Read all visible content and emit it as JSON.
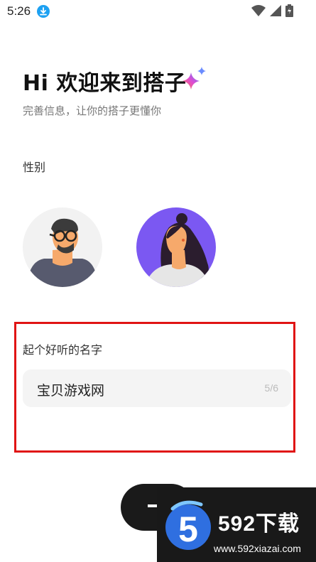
{
  "status_bar": {
    "time": "5:26",
    "icons": [
      "download-icon",
      "wifi-icon",
      "signal-icon",
      "battery-icon"
    ]
  },
  "header": {
    "title": "Hi 欢迎来到搭子",
    "subtitle": "完善信息，让你的搭子更懂你"
  },
  "gender": {
    "label": "性别",
    "options": [
      {
        "name": "male-avatar"
      },
      {
        "name": "female-avatar"
      }
    ]
  },
  "name": {
    "label": "起个好听的名字",
    "value": "宝贝游戏网",
    "counter": "5/6"
  },
  "colors": {
    "accent_purple": "#7b58f2",
    "highlight_red": "#e01414",
    "button_dark": "#1a1a1a"
  },
  "watermark": {
    "logo_digit": "5",
    "title": "592下载",
    "url": "www.592xiazai.com"
  }
}
